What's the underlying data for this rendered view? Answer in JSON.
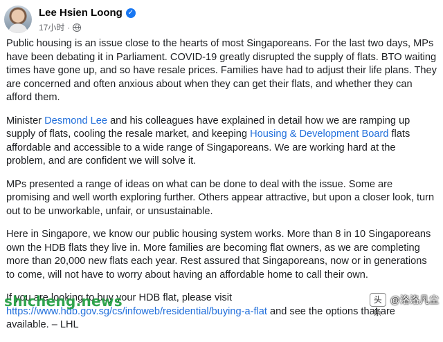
{
  "post": {
    "author": "Lee Hsien Loong",
    "time": "17小时",
    "separator": "·",
    "paragraphs": [
      {
        "text": "Public housing is an issue close to the hearts of most Singaporeans. For the last two days, MPs have been debating it in Parliament. COVID-19 greatly disrupted the supply of flats. BTO waiting times have gone up, and so have resale prices. Families have had to adjust their life plans. They are concerned and often anxious about when they can get their flats, and whether they can afford them."
      },
      {
        "before": "Minister ",
        "link1": "Desmond Lee",
        "middle": " and his colleagues have explained in detail how we are ramping up supply of flats, cooling the resale market, and keeping ",
        "link2": "Housing & Development Board",
        "after": " flats affordable and accessible to a wide range of Singaporeans. We are working hard at the problem, and are confident we will solve it."
      },
      {
        "text": "MPs presented a range of ideas on what can be done to deal with the issue. Some are promising and well worth exploring further. Others appear attractive, but upon a closer look, turn out to be unworkable, unfair, or unsustainable."
      },
      {
        "text": "Here in Singapore, we know our public housing system works. More than 8 in 10 Singaporeans own the HDB flats they live in. More families are becoming flat owners, as we are completing more than 20,000 new flats each year. Rest assured that Singaporeans, now or in generations to come, will not have to worry about having an affordable home to call their own."
      },
      {
        "before": "If you are looking to buy your HDB flat, please visit ",
        "link1": "https://www.hdb.gov.sg/cs/infoweb/residential/buying-a-flat",
        "after": " and see the options that are available. – LHL"
      }
    ]
  },
  "watermarks": {
    "left": "shicheng.news",
    "right_logo": "头条",
    "right": "@洛洛凡尘"
  },
  "colors": {
    "link": "#216fdb",
    "verified": "#1877f2",
    "meta": "#65676b"
  },
  "icons": {
    "verified": "check-badge",
    "audience": "globe"
  }
}
